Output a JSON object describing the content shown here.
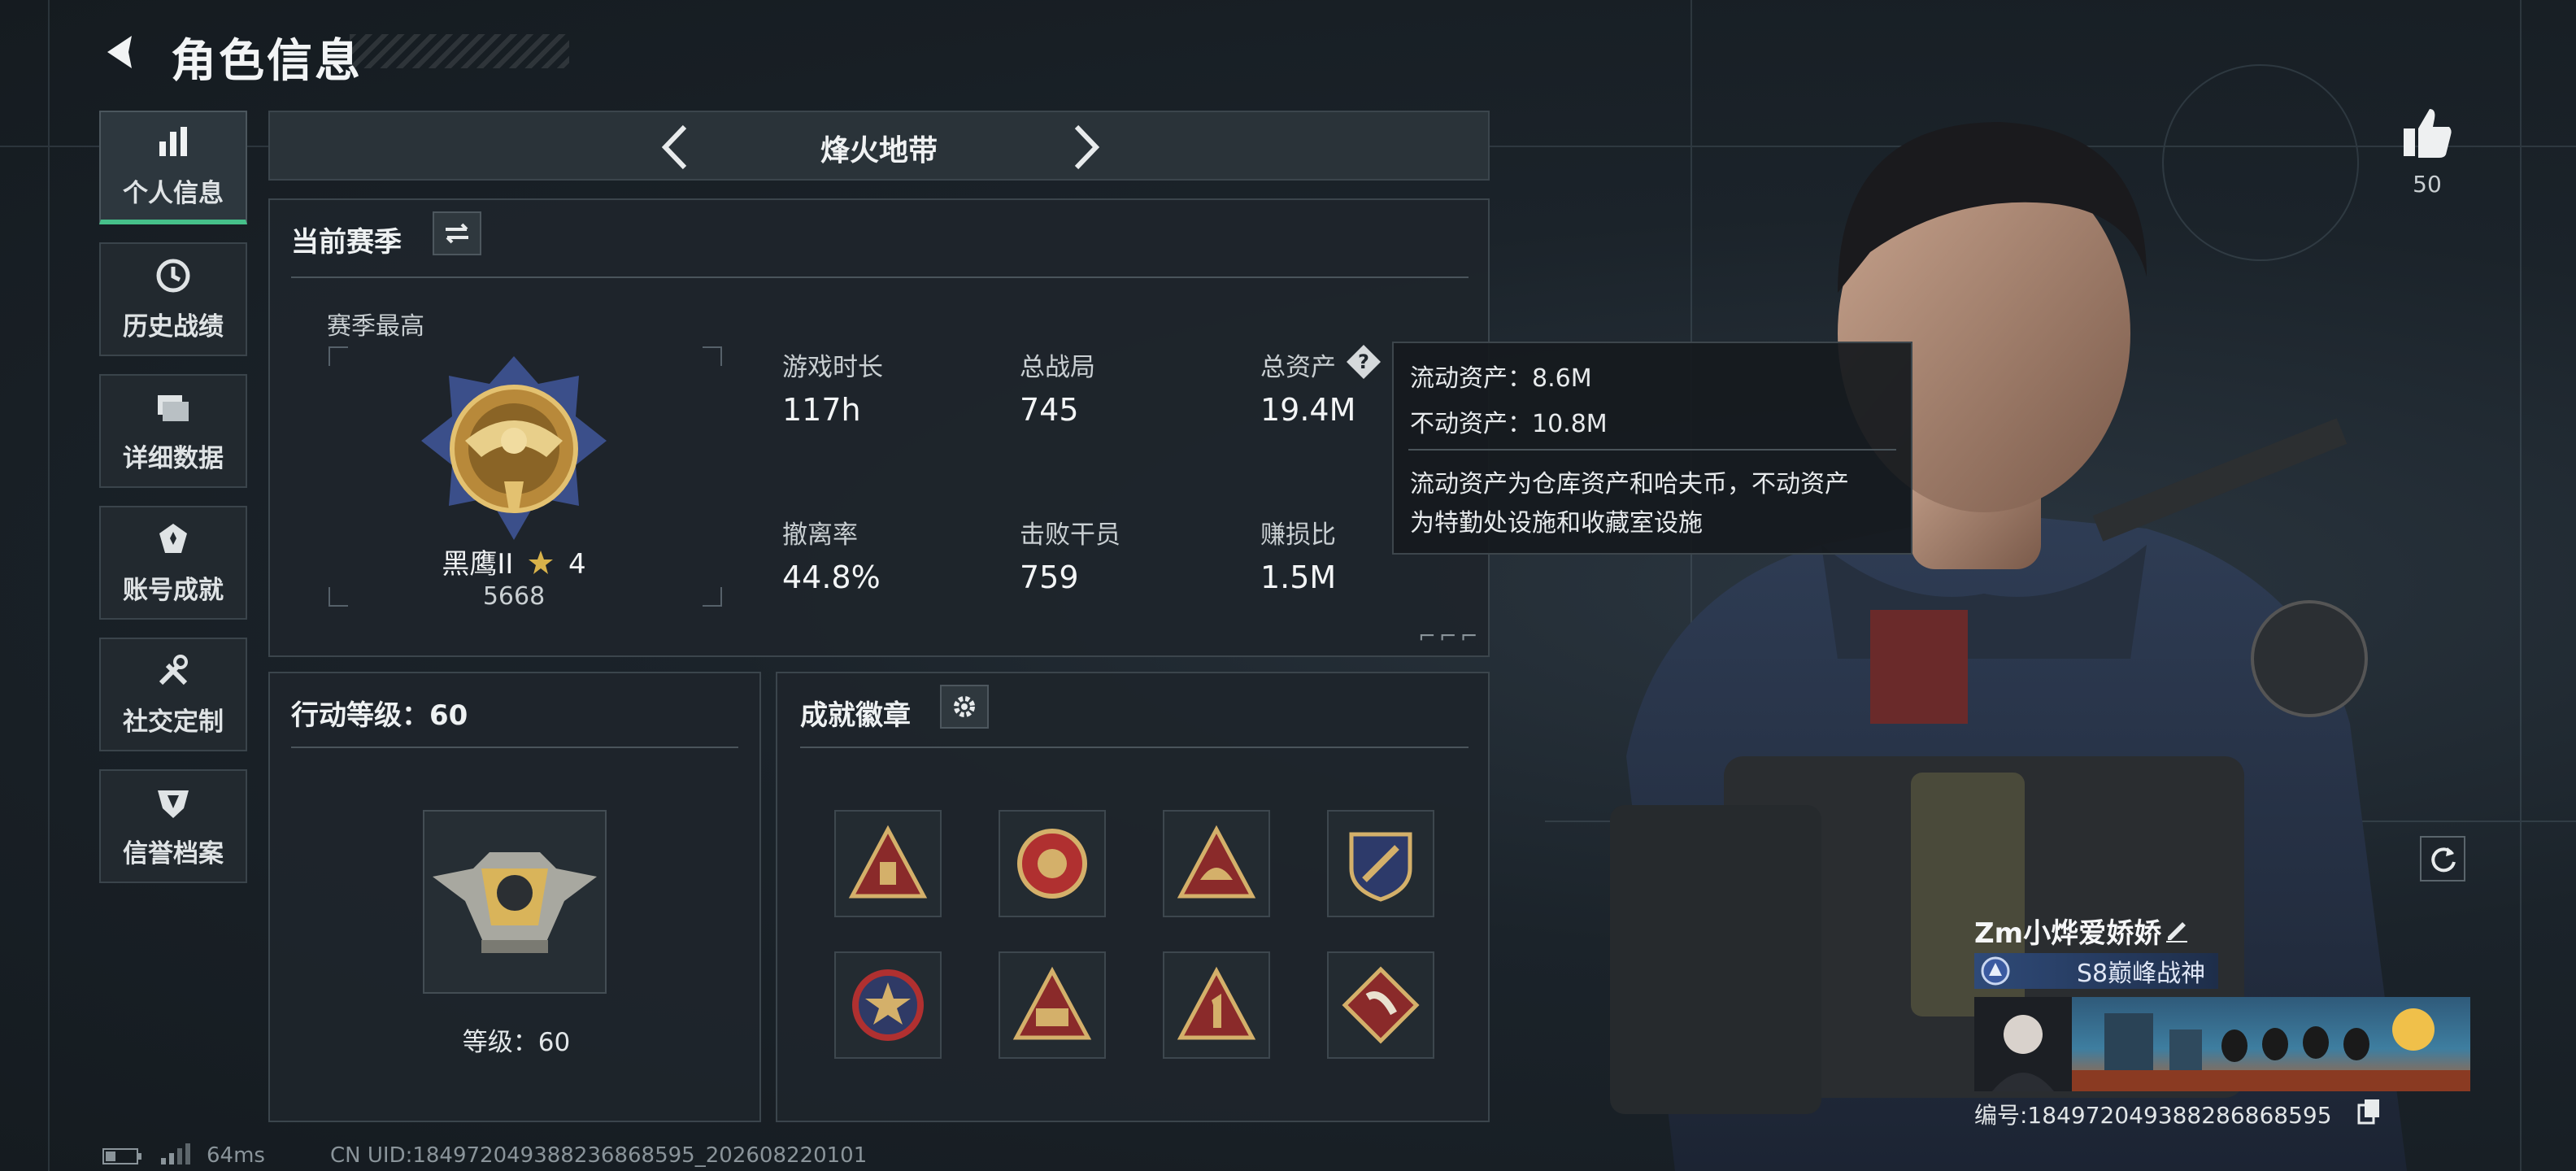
{
  "header": {
    "title": "角色信息"
  },
  "nav": [
    {
      "label": "个人信息",
      "icon": "bar-chart-icon",
      "active": true
    },
    {
      "label": "历史战绩",
      "icon": "clock-icon"
    },
    {
      "label": "详细数据",
      "icon": "folder-icon"
    },
    {
      "label": "账号成就",
      "icon": "medal-icon"
    },
    {
      "label": "社交定制",
      "icon": "tools-icon"
    },
    {
      "label": "信誉档案",
      "icon": "shield-icon"
    }
  ],
  "mode": {
    "title": "烽火地带"
  },
  "season": {
    "title": "当前赛季",
    "best_label": "赛季最高",
    "rank_name": "黑鹰II",
    "rank_stars": "4",
    "rank_score": "5668",
    "stats": [
      {
        "label": "游戏时长",
        "value": "117h"
      },
      {
        "label": "总战局",
        "value": "745"
      },
      {
        "label": "总资产",
        "value": "19.4M"
      },
      {
        "label": "撤离率",
        "value": "44.8%"
      },
      {
        "label": "击败干员",
        "value": "759"
      },
      {
        "label": "赚损比",
        "value": "1.5M"
      }
    ]
  },
  "tooltip": {
    "liquid": "流动资产：8.6M",
    "fixed": "不动资产：10.8M",
    "desc_line1": "流动资产为仓库资产和哈夫币，不动资产",
    "desc_line2": "为特勤处设施和收藏室设施"
  },
  "level": {
    "title": "行动等级：60",
    "label": "等级：60"
  },
  "achievements": {
    "title": "成就徽章",
    "badges": [
      "badge-1",
      "badge-2",
      "badge-3",
      "badge-4",
      "badge-5",
      "badge-6",
      "badge-7",
      "badge-8"
    ]
  },
  "likes": {
    "count": "50"
  },
  "profile": {
    "name": "Zm小烨爱娇娇",
    "title_badge": "S8巅峰战神",
    "id_label": "编号:18497204938828686859​5"
  },
  "footer": {
    "ping": "64ms",
    "uid": "CN UID:18497204938823686859​5_202608220101"
  },
  "colors": {
    "accent": "#46c08a",
    "panel": "#1e252b",
    "gold": "#c9a14a"
  }
}
